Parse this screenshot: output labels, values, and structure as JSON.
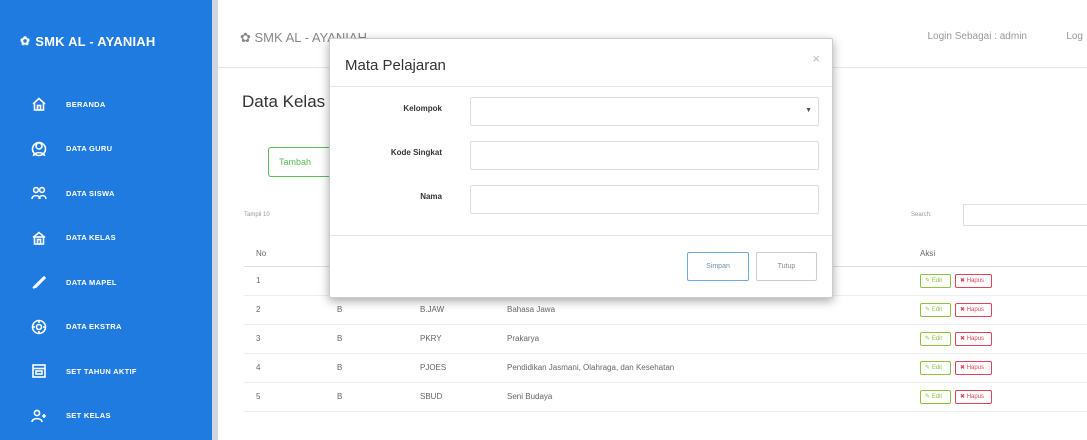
{
  "sidebar": {
    "brand": "SMK AL - AYANIAH",
    "items": [
      {
        "label": "BERANDA",
        "icon": "home-icon"
      },
      {
        "label": "DATA GURU",
        "icon": "teacher-icon"
      },
      {
        "label": "DATA SISWA",
        "icon": "students-icon"
      },
      {
        "label": "DATA KELAS",
        "icon": "class-icon"
      },
      {
        "label": "DATA MAPEL",
        "icon": "book-icon"
      },
      {
        "label": "DATA EKSTRA",
        "icon": "star-icon"
      },
      {
        "label": "SET TAHUN AKTIF",
        "icon": "calendar-icon"
      },
      {
        "label": "SET KELAS",
        "icon": "user-plus-icon"
      }
    ]
  },
  "topbar": {
    "title": "SMK AL - AYANIAH",
    "login_text": "Login Sebagai : admin",
    "logout": "Log"
  },
  "main": {
    "page_title": "Data Kelas",
    "add_button": "Tambah",
    "show_entries": "Tampil 10",
    "search_label": "Search:",
    "table": {
      "headers": [
        "No",
        "",
        "",
        "",
        "Aksi"
      ],
      "rows": [
        {
          "no": "1",
          "k": "",
          "kode": "",
          "nama": ""
        },
        {
          "no": "2",
          "k": "B",
          "kode": "B.JAW",
          "nama": "Bahasa Jawa"
        },
        {
          "no": "3",
          "k": "B",
          "kode": "PKRY",
          "nama": "Prakarya"
        },
        {
          "no": "4",
          "k": "B",
          "kode": "PJOES",
          "nama": "Pendidikan Jasmani, Olahraga, dan Kesehatan"
        },
        {
          "no": "5",
          "k": "B",
          "kode": "SBUD",
          "nama": "Seni Budaya"
        }
      ],
      "edit_label": "Edit",
      "delete_label": "Hapus"
    }
  },
  "modal": {
    "title": "Mata Pelajaran",
    "close": "×",
    "fields": [
      {
        "label": "Kelompok",
        "type": "select",
        "value": ""
      },
      {
        "label": "Kode Singkat",
        "type": "text",
        "value": ""
      },
      {
        "label": "Nama",
        "type": "text",
        "value": ""
      }
    ],
    "save_button": "Simpan",
    "close_button": "Tutup"
  },
  "colors": {
    "sidebar_bg": "#1f7be0",
    "edit": "#8cc43e",
    "delete": "#e0445a",
    "primary": "#6fa8dc"
  }
}
